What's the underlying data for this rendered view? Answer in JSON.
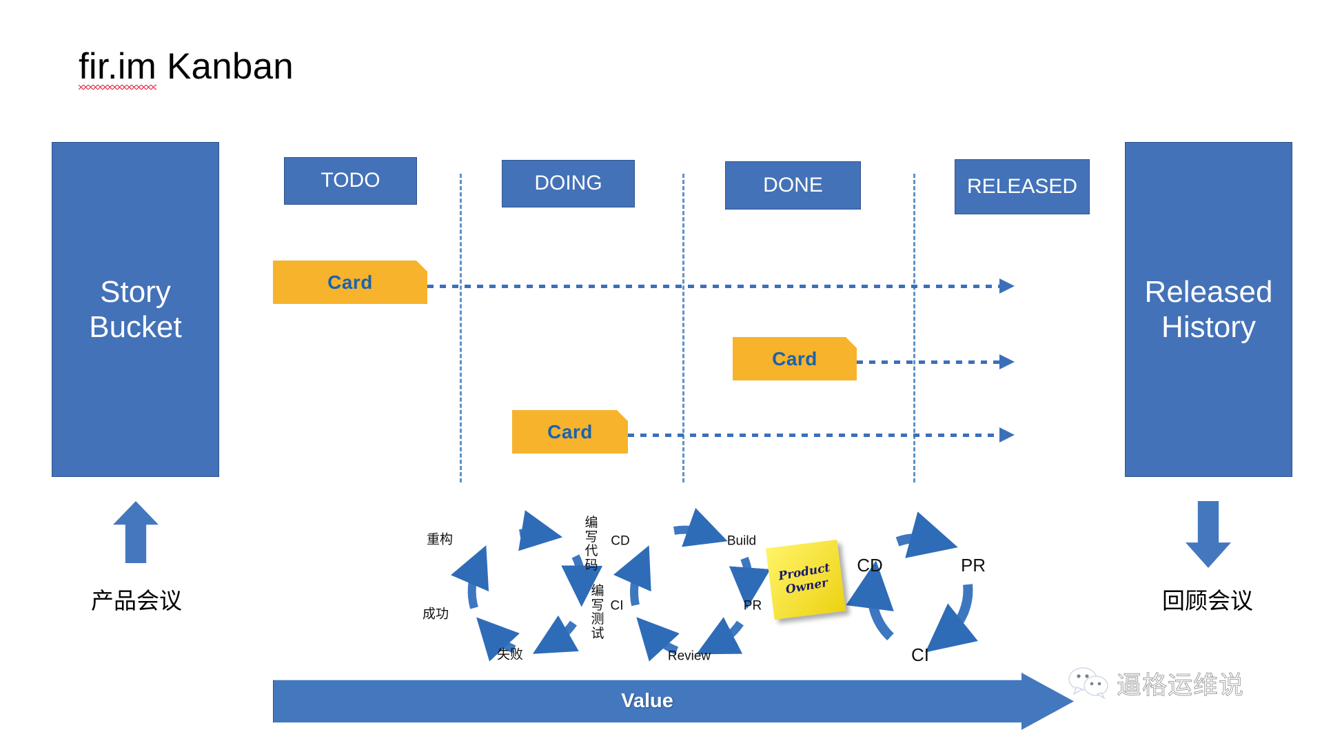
{
  "slide": {
    "title_prefix": "fir.im",
    "title_suffix": " Kanban"
  },
  "board": {
    "left_bucket": {
      "label": "Story\nBucket",
      "meeting_label": "产品会议",
      "arrow_icon": "arrow-up-icon"
    },
    "right_bucket": {
      "label": "Released\nHistory",
      "meeting_label": "回顾会议",
      "arrow_icon": "arrow-down-icon"
    },
    "columns": [
      {
        "label": "TODO"
      },
      {
        "label": "DOING"
      },
      {
        "label": "DONE"
      },
      {
        "label": "RELEASED"
      }
    ],
    "cards": [
      {
        "label": "Card",
        "lane": "todo"
      },
      {
        "label": "Card",
        "lane": "done"
      },
      {
        "label": "Card",
        "lane": "doing"
      }
    ]
  },
  "cycles": [
    {
      "name": "tdd-cycle",
      "nodes": [
        "重构",
        "编写\n代码",
        "编写\n测试",
        "失败",
        "成功"
      ]
    },
    {
      "name": "ci-cd-cycle",
      "nodes": [
        "CD",
        "Build",
        "PR",
        "Review",
        "CI"
      ]
    },
    {
      "name": "pr-ci-cd-cycle",
      "nodes": [
        "CD",
        "PR",
        "CI"
      ]
    }
  ],
  "sticky_note": {
    "text": "Product\nOwner"
  },
  "value_bar": {
    "label": "Value"
  },
  "watermark": {
    "text": "逼格运维说",
    "icon": "wechat-icon"
  },
  "colors": {
    "blue_fill": "#4472b8",
    "blue_arrow": "#4478be",
    "card_orange": "#f7b32b",
    "card_text": "#1863b0",
    "divider_blue": "#5e92c8",
    "sticky_yellow": "#f5e13a",
    "sticky_text": "#1a1a6e",
    "spellcheck_red": "#e0203c"
  }
}
